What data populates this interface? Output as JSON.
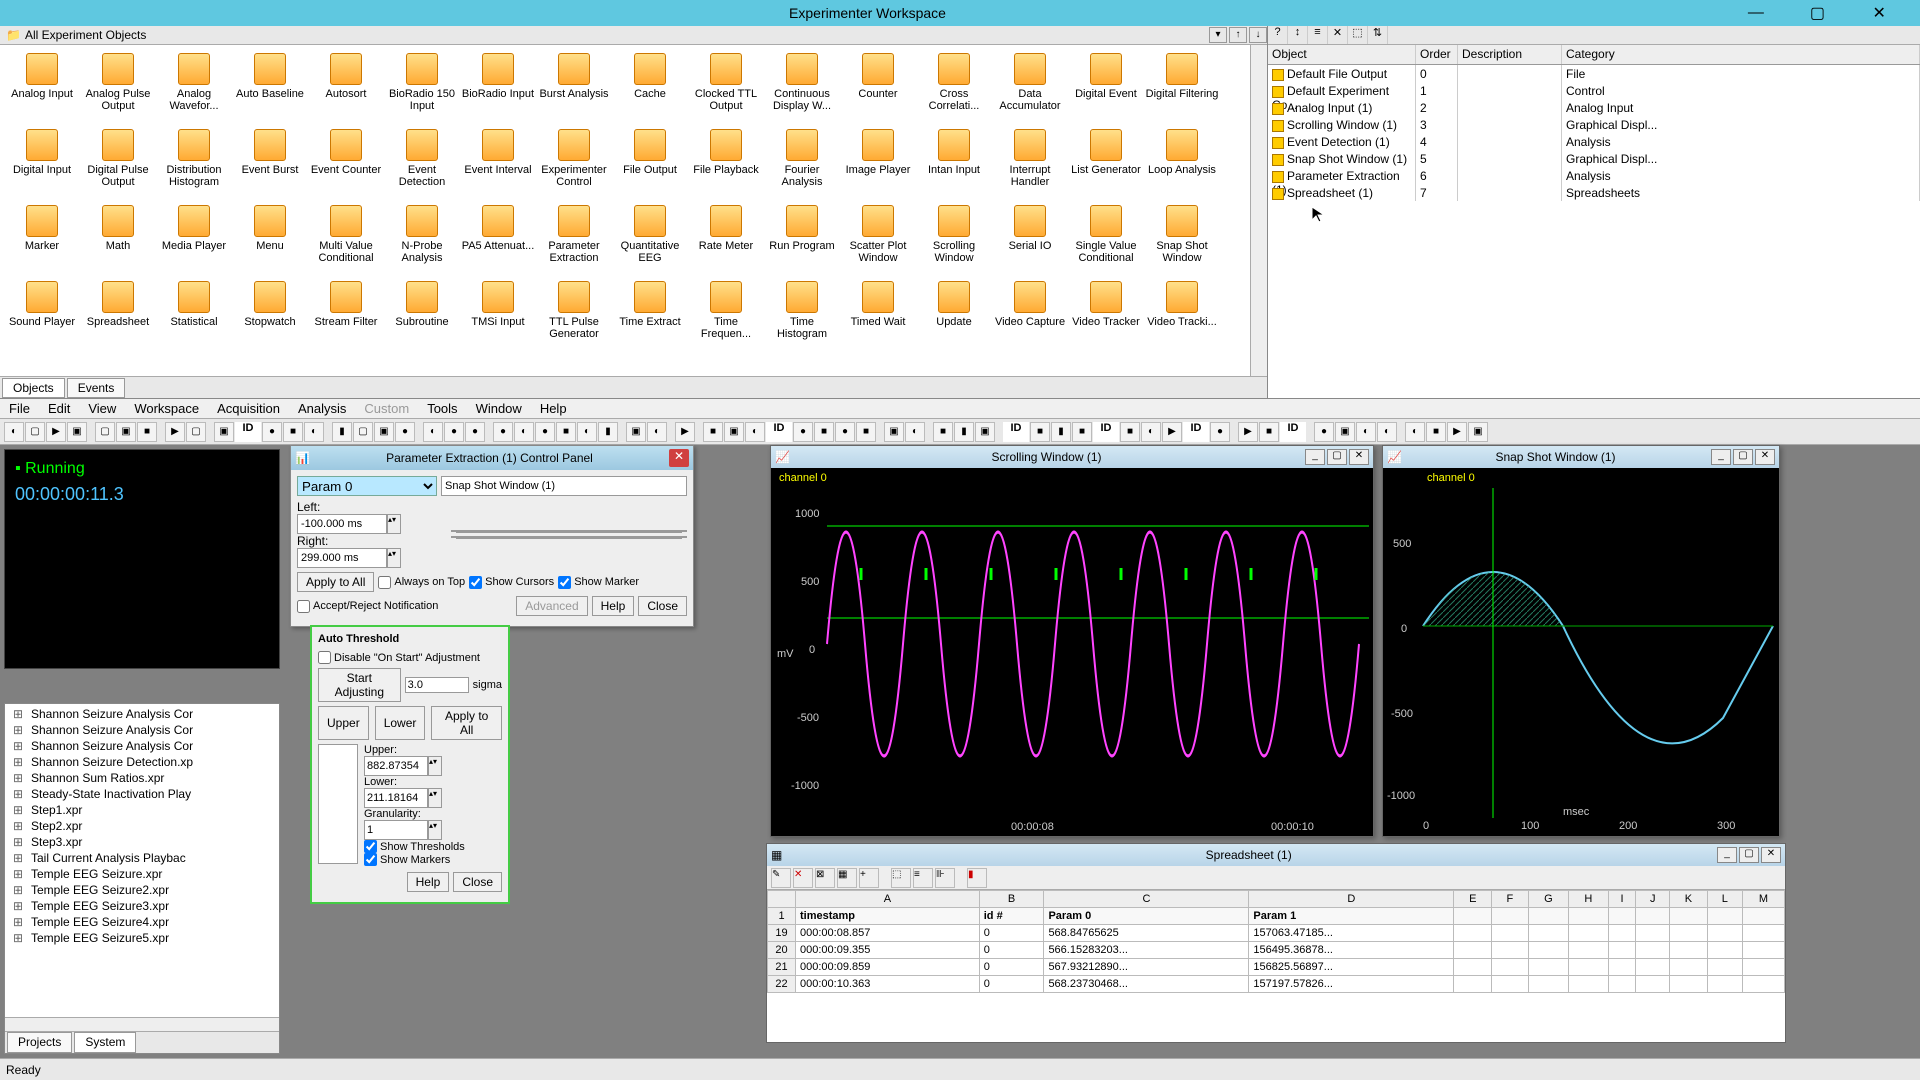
{
  "window": {
    "title": "Experimenter Workspace"
  },
  "tools_header": "All Experiment Objects",
  "tool_items": [
    "Analog Input",
    "Analog Pulse Output",
    "Analog Wavefor...",
    "Auto Baseline",
    "Autosort",
    "BioRadio 150 Input",
    "BioRadio Input",
    "Burst Analysis",
    "Cache",
    "Clocked TTL Output",
    "Continuous Display W...",
    "Counter",
    "Cross Correlati...",
    "Data Accumulator",
    "Digital Event",
    "Digital Filtering",
    "Digital Input",
    "Digital Pulse Output",
    "Distribution Histogram",
    "Event Burst",
    "Event Counter",
    "Event Detection",
    "Event Interval",
    "Experimenter Control",
    "File Output",
    "File Playback",
    "Fourier Analysis",
    "Image Player",
    "Intan Input",
    "Interrupt Handler",
    "List Generator",
    "Loop Analysis",
    "Marker",
    "Math",
    "Media Player",
    "Menu",
    "Multi Value Conditional",
    "N-Probe Analysis",
    "PA5 Attenuat...",
    "Parameter Extraction",
    "Quantitative EEG",
    "Rate Meter",
    "Run Program",
    "Scatter Plot Window",
    "Scrolling Window",
    "Serial IO",
    "Single Value Conditional",
    "Snap Shot Window",
    "Sound Player",
    "Spreadsheet",
    "Statistical",
    "Stopwatch",
    "Stream Filter",
    "Subroutine",
    "TMSi Input",
    "TTL Pulse Generator",
    "Time Extract",
    "Time Frequen...",
    "Time Histogram",
    "Timed Wait",
    "Update",
    "Video Capture",
    "Video Tracker",
    "Video Tracki..."
  ],
  "bottom_tabs": [
    "Objects",
    "Events"
  ],
  "obj_cols": [
    "Object",
    "Order",
    "Description",
    "Category"
  ],
  "obj_rows": [
    {
      "name": "Default File Output",
      "order": "0",
      "cat": "File"
    },
    {
      "name": "Default Experiment Co...",
      "order": "1",
      "cat": "Control"
    },
    {
      "name": "Analog Input (1)",
      "order": "2",
      "cat": "Analog Input"
    },
    {
      "name": "Scrolling Window (1)",
      "order": "3",
      "cat": "Graphical Displ..."
    },
    {
      "name": "Event Detection (1)",
      "order": "4",
      "cat": "Analysis"
    },
    {
      "name": "Snap Shot Window (1)",
      "order": "5",
      "cat": "Graphical Displ..."
    },
    {
      "name": "Parameter Extraction (1)",
      "order": "6",
      "cat": "Analysis"
    },
    {
      "name": "Spreadsheet (1)",
      "order": "7",
      "cat": "Spreadsheets"
    }
  ],
  "menu": [
    "File",
    "Edit",
    "View",
    "Workspace",
    "Acquisition",
    "Analysis",
    "Custom",
    "Tools",
    "Window",
    "Help"
  ],
  "run": {
    "status": "Running",
    "time": "00:00:00:11.3"
  },
  "files": [
    "Shannon Seizure Analysis Cor",
    "Shannon Seizure Analysis Cor",
    "Shannon Seizure Analysis Cor",
    "Shannon Seizure Detection.xp",
    "Shannon Sum Ratios.xpr",
    "Steady-State Inactivation Play",
    "Step1.xpr",
    "Step2.xpr",
    "Step3.xpr",
    "Tail Current Analysis Playbac",
    "Temple EEG Seizure.xpr",
    "Temple EEG Seizure2.xpr",
    "Temple EEG Seizure3.xpr",
    "Temple EEG Seizure4.xpr",
    "Temple EEG Seizure5.xpr"
  ],
  "file_tabs": [
    "Projects",
    "System"
  ],
  "ctrl": {
    "title": "Parameter Extraction (1) Control Panel",
    "param": "Param 0",
    "source": "Snap Shot Window (1)",
    "left_label": "Left:",
    "left_val": "-100.000 ms",
    "right_label": "Right:",
    "right_val": "299.000 ms",
    "apply": "Apply to All",
    "always": "Always on Top",
    "cursors": "Show Cursors",
    "marker": "Show Marker",
    "accept": "Accept/Reject Notification",
    "advanced": "Advanced",
    "help": "Help",
    "close": "Close"
  },
  "thresh": {
    "auto": "Auto Threshold",
    "disable": "Disable \"On Start\" Adjustment",
    "start": "Start Adjusting",
    "sigma_val": "3.0",
    "sigma": "sigma",
    "tab_u": "Upper",
    "tab_l": "Lower",
    "apply": "Apply to All",
    "upper_l": "Upper:",
    "upper_v": "882.87354",
    "lower_l": "Lower:",
    "lower_v": "211.18164",
    "gran_l": "Granularity:",
    "gran_v": "1",
    "show_t": "Show Thresholds",
    "show_m": "Show Markers",
    "help": "Help",
    "close": "Close"
  },
  "scroll_win": {
    "title": "Scrolling Window (1)",
    "channel": "channel 0",
    "yticks": [
      "1000",
      "500",
      "0",
      "-500",
      "-1000"
    ],
    "xticks": [
      "00:00:08",
      "00:00:10"
    ],
    "yunit": "mV"
  },
  "snap_win": {
    "title": "Snap Shot Window (1)",
    "channel": "channel 0",
    "yticks": [
      "500",
      "0",
      "-500",
      "-1000"
    ],
    "xticks": [
      "0",
      "100",
      "200",
      "300"
    ],
    "xunit": "msec"
  },
  "spread": {
    "title": "Spreadsheet (1)",
    "cols": [
      "",
      "A",
      "B",
      "C",
      "D",
      "E",
      "F",
      "G",
      "H",
      "I",
      "J",
      "K",
      "L",
      "M"
    ],
    "headers": [
      "1",
      "timestamp",
      "id #",
      "Param 0",
      "Param 1"
    ],
    "rows": [
      [
        "19",
        "000:00:08.857",
        "0",
        "568.84765625",
        "157063.47185..."
      ],
      [
        "20",
        "000:00:09.355",
        "0",
        "566.15283203...",
        "156495.36878..."
      ],
      [
        "21",
        "000:00:09.859",
        "0",
        "567.93212890...",
        "156825.56897..."
      ],
      [
        "22",
        "000:00:10.363",
        "0",
        "568.23730468...",
        "157197.57826..."
      ]
    ]
  },
  "status": "Ready",
  "chart_data": [
    {
      "type": "line",
      "title": "Scrolling Window (1)",
      "series": [
        {
          "name": "channel 0",
          "color": "#ff44ff",
          "values": "sinusoid approx ±1000 mV, ~8 cycles between 00:00:08 and 00:00:10.5"
        },
        {
          "name": "upper threshold",
          "color": "#00ff00",
          "value": 882.87
        },
        {
          "name": "lower threshold",
          "color": "#00ff00",
          "value": 211.18
        },
        {
          "name": "event markers",
          "color": "#00ff00",
          "values": "tick marks at each positive peak crossing"
        }
      ],
      "ylim": [
        -1100,
        1100
      ],
      "yunit": "mV",
      "xunit": "hh:mm:ss"
    },
    {
      "type": "line",
      "title": "Snap Shot Window (1)",
      "series": [
        {
          "name": "channel 0",
          "color": "#66ccee",
          "values": "single sine period, peak ~+570 around 60 ms, trough ~-1000 around 260 ms"
        },
        {
          "name": "shaded region",
          "desc": "hatched fill between cursors -100 to 299 ms under curve"
        }
      ],
      "xlim": [
        -10,
        330
      ],
      "ylim": [
        -1100,
        700
      ],
      "xunit": "msec"
    }
  ]
}
